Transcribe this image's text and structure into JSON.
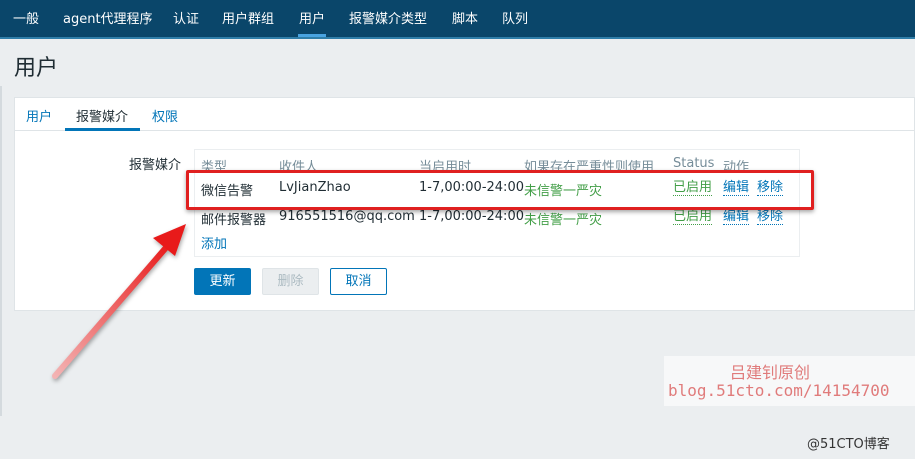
{
  "nav": {
    "items": [
      "一般",
      "agent代理程序",
      "认证",
      "用户群组",
      "用户",
      "报警媒介类型",
      "脚本",
      "队列"
    ],
    "active": "用户"
  },
  "page": {
    "title": "用户"
  },
  "tabs": [
    "用户",
    "报警媒介",
    "权限"
  ],
  "form": {
    "media_label": "报警媒介",
    "columns": [
      "类型",
      "收件人",
      "当启用时",
      "如果存在严重性则使用",
      "Status",
      "动作"
    ],
    "rows": [
      {
        "type": "微信告警",
        "recipient": "LvJianZhao",
        "when_active": "1-7,00:00-24:00",
        "severity": "未信警一严灾",
        "status": "已启用",
        "edit": "编辑",
        "remove": "移除"
      },
      {
        "type": "邮件报警器",
        "recipient": "916551516@qq.com",
        "when_active": "1-7,00:00-24:00",
        "severity": "未信警一严灾",
        "status": "已启用",
        "edit": "编辑",
        "remove": "移除"
      }
    ],
    "add_label": "添加"
  },
  "buttons": {
    "update": "更新",
    "delete": "删除",
    "cancel": "取消"
  },
  "watermark": {
    "line1": "吕建钊原创",
    "line2": "blog.51cto.com/14154700"
  },
  "site_mark": "@51CTO博客",
  "colors": {
    "navbar": "#0a466a",
    "accent": "#0275b8",
    "highlight": "#e02020",
    "status_green": "#429e47"
  }
}
